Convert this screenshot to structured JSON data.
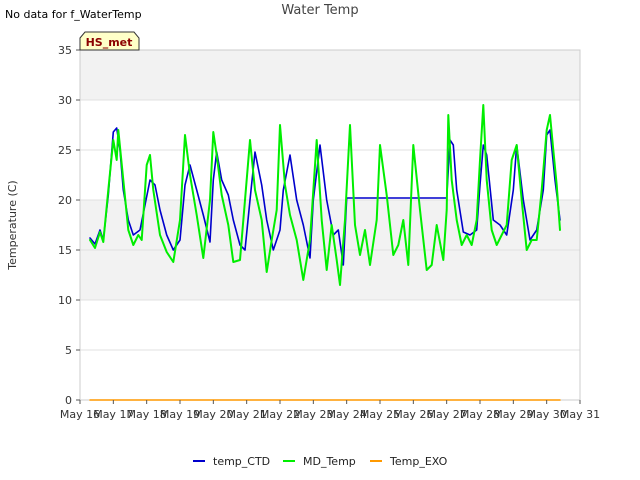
{
  "corner_note": "No data for f_WaterTemp",
  "badge_label": "HS_met",
  "chart_data": {
    "type": "line",
    "title": "Water Temp",
    "xlabel": "",
    "ylabel": "Temperature (C)",
    "ylim": [
      0,
      35
    ],
    "yticks": [
      0,
      5,
      10,
      15,
      20,
      25,
      30,
      35
    ],
    "xlim": [
      16,
      31
    ],
    "xtick_values": [
      16,
      17,
      18,
      19,
      20,
      21,
      22,
      23,
      24,
      25,
      26,
      27,
      28,
      29,
      30,
      31
    ],
    "xtick_labels": [
      "May 16",
      "May 17",
      "May 18",
      "May 19",
      "May 20",
      "May 21",
      "May 22",
      "May 23",
      "May 24",
      "May 25",
      "May 26",
      "May 27",
      "May 28",
      "May 29",
      "May 30",
      "May 31"
    ],
    "grid": "horizontal bands",
    "legend_position": "bottom",
    "series": [
      {
        "name": "temp_CTD",
        "color": "#0000cc",
        "x": [
          16.3,
          16.45,
          16.6,
          16.7,
          16.85,
          17.0,
          17.1,
          17.2,
          17.3,
          17.45,
          17.6,
          17.8,
          17.95,
          18.1,
          18.25,
          18.4,
          18.6,
          18.8,
          19.0,
          19.15,
          19.3,
          19.5,
          19.7,
          19.9,
          20.0,
          20.1,
          20.25,
          20.45,
          20.6,
          20.8,
          20.95,
          21.1,
          21.25,
          21.45,
          21.6,
          21.8,
          22.0,
          22.1,
          22.3,
          22.5,
          22.7,
          22.9,
          23.0,
          23.2,
          23.4,
          23.6,
          23.75,
          23.9,
          24.0,
          24.5,
          25.0,
          25.5,
          26.0,
          26.5,
          27.0,
          27.1,
          27.2,
          27.3,
          27.5,
          27.7,
          27.9,
          28.0,
          28.1,
          28.2,
          28.4,
          28.6,
          28.8,
          29.0,
          29.1,
          29.3,
          29.5,
          29.7,
          29.9,
          30.0,
          30.1,
          30.25,
          30.4
        ],
        "y": [
          16.2,
          15.6,
          17.0,
          16.0,
          20.5,
          26.8,
          27.2,
          25.0,
          21.0,
          18.0,
          16.5,
          17.0,
          19.5,
          22.0,
          21.5,
          19.0,
          16.5,
          15.0,
          16.0,
          21.5,
          23.5,
          21.0,
          18.5,
          15.8,
          22.0,
          24.8,
          22.0,
          20.5,
          18.0,
          15.5,
          15.0,
          20.0,
          24.8,
          21.5,
          18.0,
          15.0,
          17.0,
          21.0,
          24.5,
          20.0,
          17.5,
          14.2,
          20.0,
          25.5,
          20.0,
          16.5,
          17.0,
          13.5,
          20.2,
          20.2,
          20.2,
          20.2,
          20.2,
          20.2,
          20.2,
          26.0,
          25.5,
          21.0,
          16.8,
          16.5,
          17.0,
          21.5,
          25.5,
          24.5,
          18.0,
          17.5,
          16.5,
          21.0,
          25.5,
          20.0,
          16.0,
          17.0,
          21.0,
          26.5,
          27.0,
          22.0,
          18.0
        ]
      },
      {
        "name": "MD_Temp",
        "color": "#00ee00",
        "x": [
          16.3,
          16.45,
          16.6,
          16.7,
          16.85,
          17.0,
          17.1,
          17.15,
          17.3,
          17.45,
          17.6,
          17.75,
          17.85,
          18.0,
          18.1,
          18.2,
          18.4,
          18.6,
          18.8,
          19.0,
          19.15,
          19.3,
          19.5,
          19.7,
          19.9,
          20.0,
          20.1,
          20.25,
          20.45,
          20.6,
          20.8,
          20.95,
          21.1,
          21.25,
          21.45,
          21.6,
          21.75,
          21.9,
          22.0,
          22.15,
          22.3,
          22.5,
          22.7,
          22.9,
          23.1,
          23.25,
          23.4,
          23.55,
          23.7,
          23.8,
          23.95,
          24.1,
          24.25,
          24.4,
          24.55,
          24.7,
          24.9,
          25.0,
          25.2,
          25.4,
          25.55,
          25.7,
          25.85,
          26.0,
          26.2,
          26.4,
          26.55,
          26.7,
          26.9,
          27.0,
          27.05,
          27.15,
          27.3,
          27.45,
          27.6,
          27.75,
          27.9,
          28.0,
          28.1,
          28.2,
          28.35,
          28.5,
          28.65,
          28.8,
          28.95,
          29.1,
          29.25,
          29.4,
          29.55,
          29.7,
          29.85,
          30.0,
          30.1,
          30.2,
          30.3,
          30.4
        ],
        "y": [
          16.0,
          15.2,
          16.8,
          15.8,
          21.0,
          26.0,
          24.0,
          27.0,
          22.0,
          17.0,
          15.5,
          16.5,
          16.0,
          23.5,
          24.5,
          21.0,
          16.5,
          14.8,
          13.8,
          18.0,
          26.5,
          22.5,
          18.5,
          14.2,
          20.0,
          26.8,
          24.5,
          20.5,
          17.5,
          13.8,
          14.0,
          20.0,
          26.0,
          21.0,
          18.0,
          12.8,
          16.0,
          19.0,
          27.5,
          21.5,
          18.5,
          16.0,
          12.0,
          16.0,
          26.0,
          18.0,
          13.0,
          17.5,
          14.0,
          11.5,
          18.0,
          27.5,
          17.5,
          14.5,
          17.0,
          13.5,
          18.0,
          25.5,
          20.5,
          14.5,
          15.5,
          18.0,
          13.5,
          25.5,
          19.0,
          13.0,
          13.5,
          17.5,
          14.0,
          19.0,
          28.5,
          22.0,
          18.0,
          15.5,
          16.5,
          15.5,
          18.0,
          24.0,
          29.5,
          22.0,
          17.0,
          15.5,
          16.5,
          17.5,
          24.0,
          25.5,
          20.0,
          15.0,
          16.0,
          16.0,
          21.0,
          27.0,
          28.5,
          25.0,
          21.5,
          17.0
        ]
      },
      {
        "name": "Temp_EXO",
        "color": "#ff9900",
        "x": [
          16.3,
          30.4
        ],
        "y": [
          0.0,
          0.0
        ]
      }
    ]
  }
}
